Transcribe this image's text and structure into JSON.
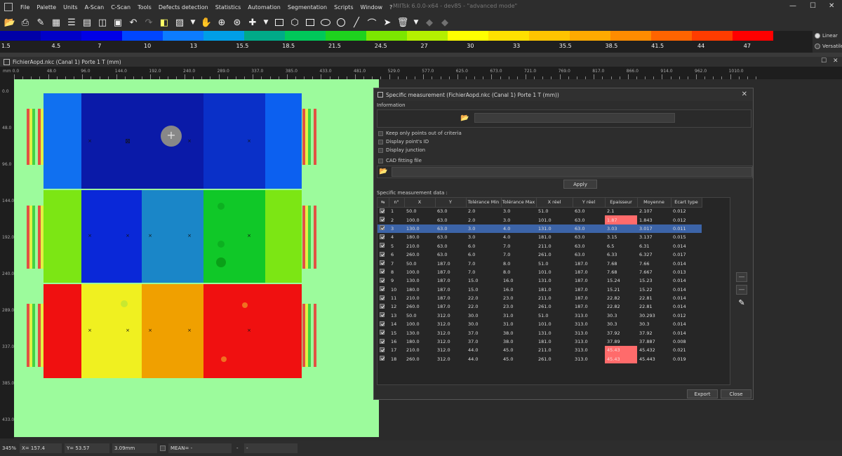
{
  "menubar": {
    "items": [
      "File",
      "Palette",
      "Units",
      "A-Scan",
      "C-Scan",
      "Tools",
      "Defects detection",
      "Statistics",
      "Automation",
      "Segmentation",
      "Scripts",
      "Window",
      "?"
    ],
    "title": "MIITsk 6.0.0-x64 - dev85 - \"advanced mode\"",
    "minimize": "—",
    "maximize": "☐",
    "close": "✕"
  },
  "palette": {
    "colors": [
      "#0000a8",
      "#0000c8",
      "#0000e6",
      "#0046ff",
      "#0c7cff",
      "#009ee6",
      "#00aa88",
      "#00c85a",
      "#1ed21e",
      "#7ce600",
      "#b4f000",
      "#ffff00",
      "#ffe000",
      "#ffc400",
      "#ffaa00",
      "#ff8c00",
      "#ff6400",
      "#ff3c00",
      "#ff0000",
      "#1f1f1f"
    ],
    "labels": [
      "1.5",
      "4.5",
      "7",
      "10",
      "13",
      "15.5",
      "18.5",
      "21.5",
      "24.5",
      "27",
      "30",
      "33",
      "35.5",
      "38.5",
      "41.5",
      "44",
      "47"
    ],
    "options": {
      "linear": "Linear",
      "versatile": "Versatile"
    }
  },
  "document": {
    "title": "FichierAopd.nkc (Canal 1) Porte 1 T (mm)"
  },
  "ruler_top": [
    "mm 0.0",
    "48.0",
    "96.0",
    "144.0",
    "192.0",
    "240.0",
    "289.0",
    "337.0",
    "385.0",
    "433.0",
    "481.0",
    "529.0",
    "577.0",
    "625.0",
    "673.0",
    "721.0",
    "769.0",
    "817.0",
    "866.0",
    "914.0",
    "962.0",
    "1010.0"
  ],
  "ruler_left": [
    "0.0",
    "48.0",
    "96.0",
    "144.0",
    "192.0",
    "240.0",
    "289.0",
    "337.0",
    "385.0",
    "433.0"
  ],
  "dialog": {
    "title": "Specific measurement (FichierAopd.nkc (Canal 1) Porte 1 T (mm))",
    "information_label": "Information",
    "checkboxes": [
      "Keep only points out of criteria",
      "Display point's ID",
      "Display junction"
    ],
    "cad_label": "CAD fitting file",
    "apply": "Apply",
    "data_label": "Specific measurement data :",
    "columns": [
      "n°",
      "X",
      "Y",
      "Tolérance Min",
      "Tolérance Max",
      "X réel",
      "Y réel",
      "Epaisseur",
      "Moyenne",
      "Ecart type"
    ],
    "rows": [
      [
        "1",
        "50.0",
        "63.0",
        "2.0",
        "3.0",
        "51.0",
        "63.0",
        "2.1",
        "2.107",
        "0.012"
      ],
      [
        "2",
        "100.0",
        "63.0",
        "2.0",
        "3.0",
        "101.0",
        "63.0",
        "1.87",
        "1.843",
        "0.012"
      ],
      [
        "3",
        "130.0",
        "63.0",
        "3.0",
        "4.0",
        "131.0",
        "63.0",
        "3.03",
        "3.017",
        "0.011"
      ],
      [
        "4",
        "180.0",
        "63.0",
        "3.0",
        "4.0",
        "181.0",
        "63.0",
        "3.15",
        "3.137",
        "0.015"
      ],
      [
        "5",
        "210.0",
        "63.0",
        "6.0",
        "7.0",
        "211.0",
        "63.0",
        "6.5",
        "6.31",
        "0.014"
      ],
      [
        "6",
        "260.0",
        "63.0",
        "6.0",
        "7.0",
        "261.0",
        "63.0",
        "6.33",
        "6.327",
        "0.017"
      ],
      [
        "7",
        "50.0",
        "187.0",
        "7.0",
        "8.0",
        "51.0",
        "187.0",
        "7.68",
        "7.66",
        "0.014"
      ],
      [
        "8",
        "100.0",
        "187.0",
        "7.0",
        "8.0",
        "101.0",
        "187.0",
        "7.68",
        "7.667",
        "0.013"
      ],
      [
        "9",
        "130.0",
        "187.0",
        "15.0",
        "16.0",
        "131.0",
        "187.0",
        "15.24",
        "15.23",
        "0.014"
      ],
      [
        "10",
        "180.0",
        "187.0",
        "15.0",
        "16.0",
        "181.0",
        "187.0",
        "15.21",
        "15.22",
        "0.014"
      ],
      [
        "11",
        "210.0",
        "187.0",
        "22.0",
        "23.0",
        "211.0",
        "187.0",
        "22.82",
        "22.81",
        "0.014"
      ],
      [
        "12",
        "260.0",
        "187.0",
        "22.0",
        "23.0",
        "261.0",
        "187.0",
        "22.82",
        "22.81",
        "0.014"
      ],
      [
        "13",
        "50.0",
        "312.0",
        "30.0",
        "31.0",
        "51.0",
        "313.0",
        "30.3",
        "30.293",
        "0.012"
      ],
      [
        "14",
        "100.0",
        "312.0",
        "30.0",
        "31.0",
        "101.0",
        "313.0",
        "30.3",
        "30.3",
        "0.014"
      ],
      [
        "15",
        "130.0",
        "312.0",
        "37.0",
        "38.0",
        "131.0",
        "313.0",
        "37.92",
        "37.92",
        "0.014"
      ],
      [
        "16",
        "180.0",
        "312.0",
        "37.0",
        "38.0",
        "181.0",
        "313.0",
        "37.89",
        "37.887",
        "0.008"
      ],
      [
        "17",
        "210.0",
        "312.0",
        "44.0",
        "45.0",
        "211.0",
        "313.0",
        "45.43",
        "45.432",
        "0.021"
      ],
      [
        "18",
        "260.0",
        "312.0",
        "44.0",
        "45.0",
        "261.0",
        "313.0",
        "45.43",
        "45.443",
        "0.019"
      ]
    ],
    "red_rows": [
      2,
      17,
      18
    ],
    "selected_row": 3,
    "export": "Export",
    "close": "Close",
    "side_buttons": [
      "—",
      "—",
      "✎"
    ]
  },
  "status": {
    "zoom": "345%",
    "x": "X= 157.4",
    "y": "Y= 53.57",
    "value": "3.09mm",
    "mean": "MEAN= -",
    "dash": "-",
    "dash2": "-"
  }
}
